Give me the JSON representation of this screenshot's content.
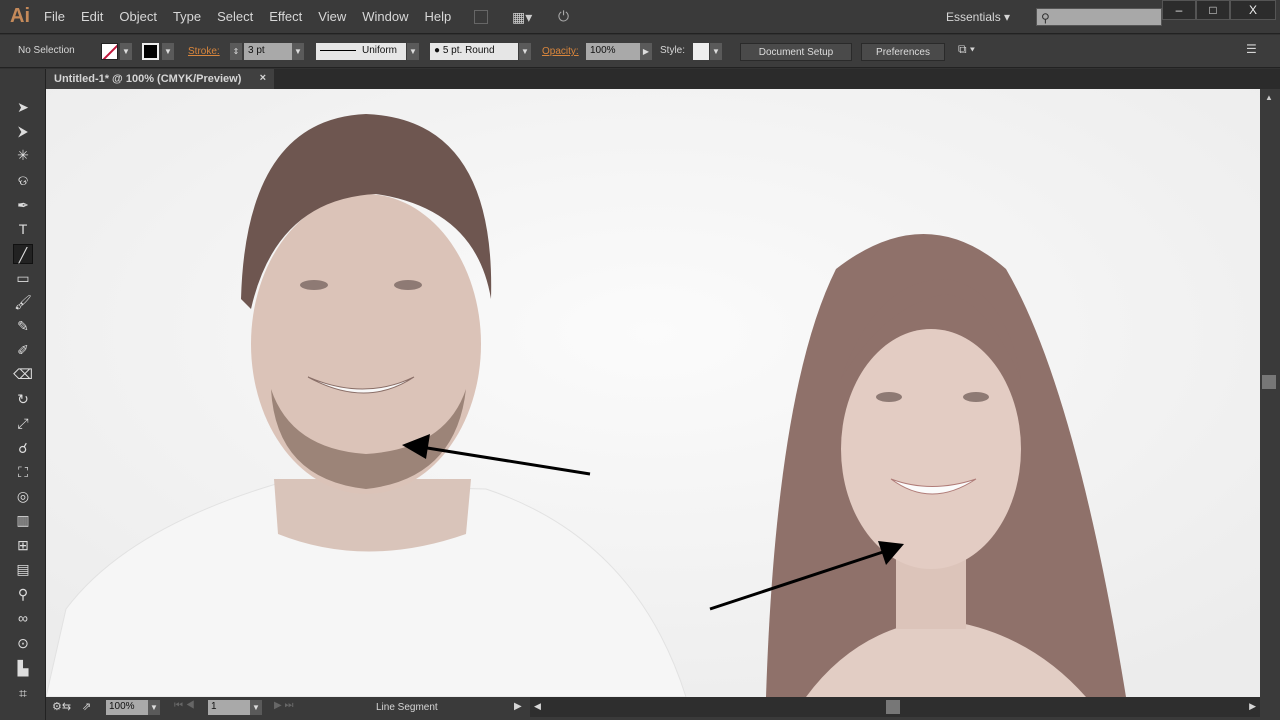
{
  "app": {
    "logo": "Ai"
  },
  "menu": [
    "File",
    "Edit",
    "Object",
    "Type",
    "Select",
    "Effect",
    "View",
    "Window",
    "Help"
  ],
  "workspace": "Essentials",
  "window_controls": {
    "minimize": "–",
    "maximize": "□",
    "close": "X"
  },
  "control": {
    "selection": "No Selection",
    "stroke_label": "Stroke:",
    "stroke_weight": "3 pt",
    "profile": "Uniform",
    "brush": "5 pt. Round",
    "opacity_label": "Opacity:",
    "opacity": "100%",
    "style_label": "Style:",
    "document_setup": "Document Setup",
    "preferences": "Preferences"
  },
  "document_tab": {
    "title": "Untitled-1* @ 100% (CMYK/Preview)",
    "close": "×"
  },
  "status": {
    "zoom": "100%",
    "artboard": "1",
    "tool_name": "Line Segment"
  },
  "tools": [
    "selection",
    "direct-selection",
    "magic-wand",
    "lasso",
    "pen",
    "type",
    "line-segment",
    "rectangle",
    "paintbrush",
    "pencil",
    "blob-brush",
    "eraser",
    "rotate",
    "scale",
    "warp",
    "free-transform",
    "shape-builder",
    "perspective-grid",
    "mesh",
    "gradient",
    "eyedropper",
    "blend",
    "symbol-sprayer",
    "column-graph",
    "artboard"
  ]
}
